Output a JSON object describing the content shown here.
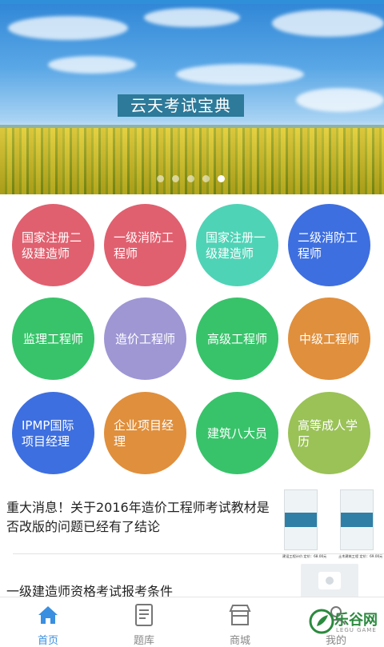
{
  "banner": {
    "title": "云天考试宝典",
    "dots_total": 5,
    "dots_active_index": 4
  },
  "colors": {
    "red": "#e0606f",
    "blue": "#3e6fe0",
    "teal": "#4fd3b6",
    "green": "#38c36a",
    "purple": "#9e97d4",
    "orange": "#e08f3c",
    "lime": "#9ac257",
    "accent": "#3a8fe0"
  },
  "categories": [
    {
      "label": "国家注册二级建造师",
      "color": "#e0606f"
    },
    {
      "label": "一级消防工程师",
      "color": "#e0606f"
    },
    {
      "label": "国家注册一级建造师",
      "color": "#4fd3b6"
    },
    {
      "label": "二级消防工程师",
      "color": "#3e6fe0"
    },
    {
      "label": "监理工程师",
      "color": "#38c36a"
    },
    {
      "label": "造价工程师",
      "color": "#9e97d4"
    },
    {
      "label": "高级工程师",
      "color": "#38c36a"
    },
    {
      "label": "中级工程师",
      "color": "#e08f3c"
    },
    {
      "label": "IPMP国际项目经理",
      "color": "#3e6fe0"
    },
    {
      "label": "企业项目经理",
      "color": "#e08f3c"
    },
    {
      "label": "建筑八大员",
      "color": "#38c36a"
    },
    {
      "label": "高等成人学历",
      "color": "#9ac257"
    }
  ],
  "news": [
    {
      "title_line1": "重大消息！关于2016年造价工程师考试教材是",
      "title_line2": "否改版的问题已经有了结论",
      "thumb1_caption": "建设工程计价 定价：68.00元",
      "thumb2_caption": "土木建筑工程 定价：69.00元"
    },
    {
      "title_line1": "一级建造师资格考试报考条件"
    }
  ],
  "tabs": [
    {
      "label": "首页",
      "icon": "home-icon",
      "active": true
    },
    {
      "label": "题库",
      "icon": "document-icon",
      "active": false
    },
    {
      "label": "商城",
      "icon": "store-icon",
      "active": false
    },
    {
      "label": "我的",
      "icon": "user-icon",
      "active": false
    }
  ],
  "watermark": {
    "text": "乐谷网",
    "sub": "LEGU GAME"
  }
}
